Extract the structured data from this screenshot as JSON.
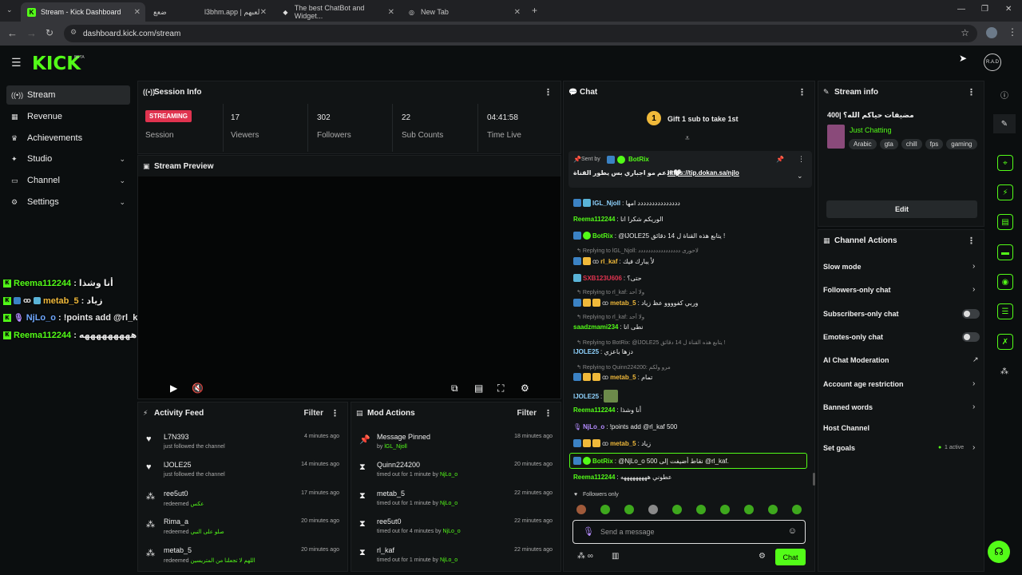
{
  "browser": {
    "tabs": [
      {
        "label": "Stream - Kick Dashboard",
        "active": true
      },
      {
        "label": "ضعع",
        "active": false
      },
      {
        "label": "l3bhm.app | لعبهم",
        "active": false
      },
      {
        "label": "The best ChatBot and Widget...",
        "active": false
      },
      {
        "label": "New Tab",
        "active": false
      }
    ],
    "url": "dashboard.kick.com/stream"
  },
  "header": {
    "logo": "KICK",
    "beta": "BETA",
    "avatar_text": "R.A.D"
  },
  "sidebar": {
    "items": [
      {
        "label": "Stream",
        "icon": "stream-icon"
      },
      {
        "label": "Revenue",
        "icon": "revenue-icon"
      },
      {
        "label": "Achievements",
        "icon": "trophy-icon"
      },
      {
        "label": "Studio",
        "icon": "studio-icon"
      },
      {
        "label": "Channel",
        "icon": "channel-icon"
      },
      {
        "label": "Settings",
        "icon": "gear-icon"
      }
    ]
  },
  "overlay_chat": [
    {
      "user": "Reema112244",
      "text": ": أنا وشذا",
      "color": "#53fc18"
    },
    {
      "user": "metab_5",
      "text": ": زياد",
      "color": "#f0b93a"
    },
    {
      "user": "NjLo_o",
      "text": ": !points add @rl_kaf 500",
      "color": "#6fa8ff"
    },
    {
      "user": "Reema112244",
      "text": ": عطوني هههههههههه",
      "color": "#53fc18"
    }
  ],
  "session": {
    "title": "Session Info",
    "status": "STREAMING",
    "status_label": "Session",
    "stats": [
      {
        "value": "17",
        "label": "Viewers"
      },
      {
        "value": "302",
        "label": "Followers"
      },
      {
        "value": "22",
        "label": "Sub Counts"
      },
      {
        "value": "04:41:58",
        "label": "Time Live"
      }
    ]
  },
  "preview": {
    "title": "Stream Preview"
  },
  "activity": {
    "title": "Activity Feed",
    "filter": "Filter",
    "rows": [
      {
        "name": "L7N393",
        "sub": "just followed the channel",
        "extra": "",
        "time": "4 minutes ago",
        "icon": "heart-icon"
      },
      {
        "name": "lJOLE25",
        "sub": "just followed the channel",
        "extra": "",
        "time": "14 minutes ago",
        "icon": "heart-icon"
      },
      {
        "name": "ree5ut0",
        "sub": "redeemed",
        "extra": "عكس",
        "time": "17 minutes ago",
        "icon": "redeem-icon"
      },
      {
        "name": "Rima_a",
        "sub": "redeemed",
        "extra": "صلو على النبي",
        "time": "20 minutes ago",
        "icon": "redeem-icon"
      },
      {
        "name": "metab_5",
        "sub": "redeemed",
        "extra": "اللهم لا تجعلنا من المتريسين",
        "time": "20 minutes ago",
        "icon": "redeem-icon"
      }
    ]
  },
  "mod": {
    "title": "Mod Actions",
    "filter": "Filter",
    "rows": [
      {
        "name": "Message Pinned",
        "sub": "by",
        "extra": "lGL_Njoll",
        "time": "18 minutes ago",
        "icon": "pin-icon"
      },
      {
        "name": "Quinn224200",
        "sub": "timed out for 1 minute by",
        "extra": "NjLo_o",
        "time": "20 minutes ago",
        "icon": "hourglass-icon"
      },
      {
        "name": "metab_5",
        "sub": "timed out for 1 minute by",
        "extra": "NjLo_o",
        "time": "22 minutes ago",
        "icon": "hourglass-icon"
      },
      {
        "name": "ree5ut0",
        "sub": "timed out for 4 minutes by",
        "extra": "NjLo_o",
        "time": "22 minutes ago",
        "icon": "hourglass-icon"
      },
      {
        "name": "rl_kaf",
        "sub": "timed out for 1 minute by",
        "extra": "NjLo_o",
        "time": "22 minutes ago",
        "icon": "hourglass-icon"
      }
    ]
  },
  "chat": {
    "title": "Chat",
    "gift": "Gift 1 sub to take 1st",
    "gift_count": "1",
    "pinned_by": "Sent by",
    "pinned_user": "BotRix",
    "pinned_text": "ادعم مو اجباري بس يطور القناة 🤍",
    "pinned_link": "https://tip.dokan.sa/njlo",
    "messages": [
      {
        "user": "lGL_Njoll",
        "text": ": ددددددددددددددد امها",
        "color": "#8fd3ff",
        "reply": false
      },
      {
        "user": "Reema112244",
        "text": ": الوريكم شكرا انا",
        "color": "#53fc18",
        "reply": false
      },
      {
        "user": "BotRix",
        "text": ": @lJOLE25 يتابع هذه القناة ل 14 دقائق !",
        "color": "#53fc18",
        "reply": false
      },
      {
        "user": "",
        "text": "Replying to lGL_Njoll: لاحورى ددددددددددددددددد",
        "color": "#888",
        "reply": true
      },
      {
        "user": "rl_kaf",
        "text": ": لأ يبارك فيك",
        "color": "#f0b93a",
        "reply": false
      },
      {
        "user": "SXB123U606",
        "text": ": حتى؟",
        "color": "#e0334f",
        "reply": false
      },
      {
        "user": "",
        "text": "Replying to rl_kaf: ولا أحد",
        "color": "#888",
        "reply": true
      },
      {
        "user": "metab_5",
        "text": ": وربي كفوووو عظ زياد",
        "color": "#f0b93a",
        "reply": false
      },
      {
        "user": "",
        "text": "Replying to rl_kaf: ولا أحد",
        "color": "#888",
        "reply": true
      },
      {
        "user": "saadzmami234",
        "text": ": نطى انا",
        "color": "#53fc18",
        "reply": false
      },
      {
        "user": "",
        "text": "Replying to BotRix: @lJOLE25 يتابع هذه القناة ل 14 دقائق !",
        "color": "#888",
        "reply": true
      },
      {
        "user": "lJOLE25",
        "text": ": دزها باعزي",
        "color": "#8fd3ff",
        "reply": false
      },
      {
        "user": "",
        "text": "Replying to Quinn224200: مرو ولكم",
        "color": "#888",
        "reply": true
      },
      {
        "user": "metab_5",
        "text": ": تمام",
        "color": "#f0b93a",
        "reply": false
      },
      {
        "user": "lJOLE25",
        "text": ":",
        "color": "#8fd3ff",
        "reply": false
      },
      {
        "user": "Reema112244",
        "text": ": أنا وشذا",
        "color": "#53fc18",
        "reply": false
      },
      {
        "user": "NjLo_o",
        "text": ": !points add @rl_kaf 500",
        "color": "#b58cff",
        "reply": false
      },
      {
        "user": "metab_5",
        "text": ": زياد",
        "color": "#f0b93a",
        "reply": false
      },
      {
        "user": "BotRix",
        "text": ": @NjLo_o 500 نقاط أضيفت إلى @rl_kaf.",
        "color": "#53fc18",
        "reply": false
      },
      {
        "user": "Reema112244",
        "text": ": عطوني هههههههههه",
        "color": "#53fc18",
        "reply": false
      }
    ],
    "followers_only": "Followers only",
    "input_placeholder": "Send a message",
    "send": "Chat"
  },
  "stream_info": {
    "title": "Stream info",
    "stream_title": "400| مضيفات حياكم الله؟",
    "category": "Just Chatting",
    "tags": [
      "Arabic",
      "gta",
      "chill",
      "fps",
      "gaming"
    ],
    "edit": "Edit"
  },
  "channel_actions": {
    "title": "Channel Actions",
    "items": [
      {
        "label": "Slow mode",
        "control": "chevron"
      },
      {
        "label": "Followers-only chat",
        "control": "chevron"
      },
      {
        "label": "Subscribers-only chat",
        "control": "toggle"
      },
      {
        "label": "Emotes-only chat",
        "control": "toggle"
      },
      {
        "label": "AI Chat Moderation",
        "control": "external"
      },
      {
        "label": "Account age restriction",
        "control": "chevron"
      },
      {
        "label": "Banned words",
        "control": "chevron"
      },
      {
        "label": "Host Channel",
        "control": "none"
      },
      {
        "label": "Set goals",
        "control": "chevron"
      }
    ],
    "goals_active": "1 active"
  },
  "colors": {
    "accent": "#53fc18",
    "panel": "#111415",
    "bg": "#0b0e0f"
  }
}
